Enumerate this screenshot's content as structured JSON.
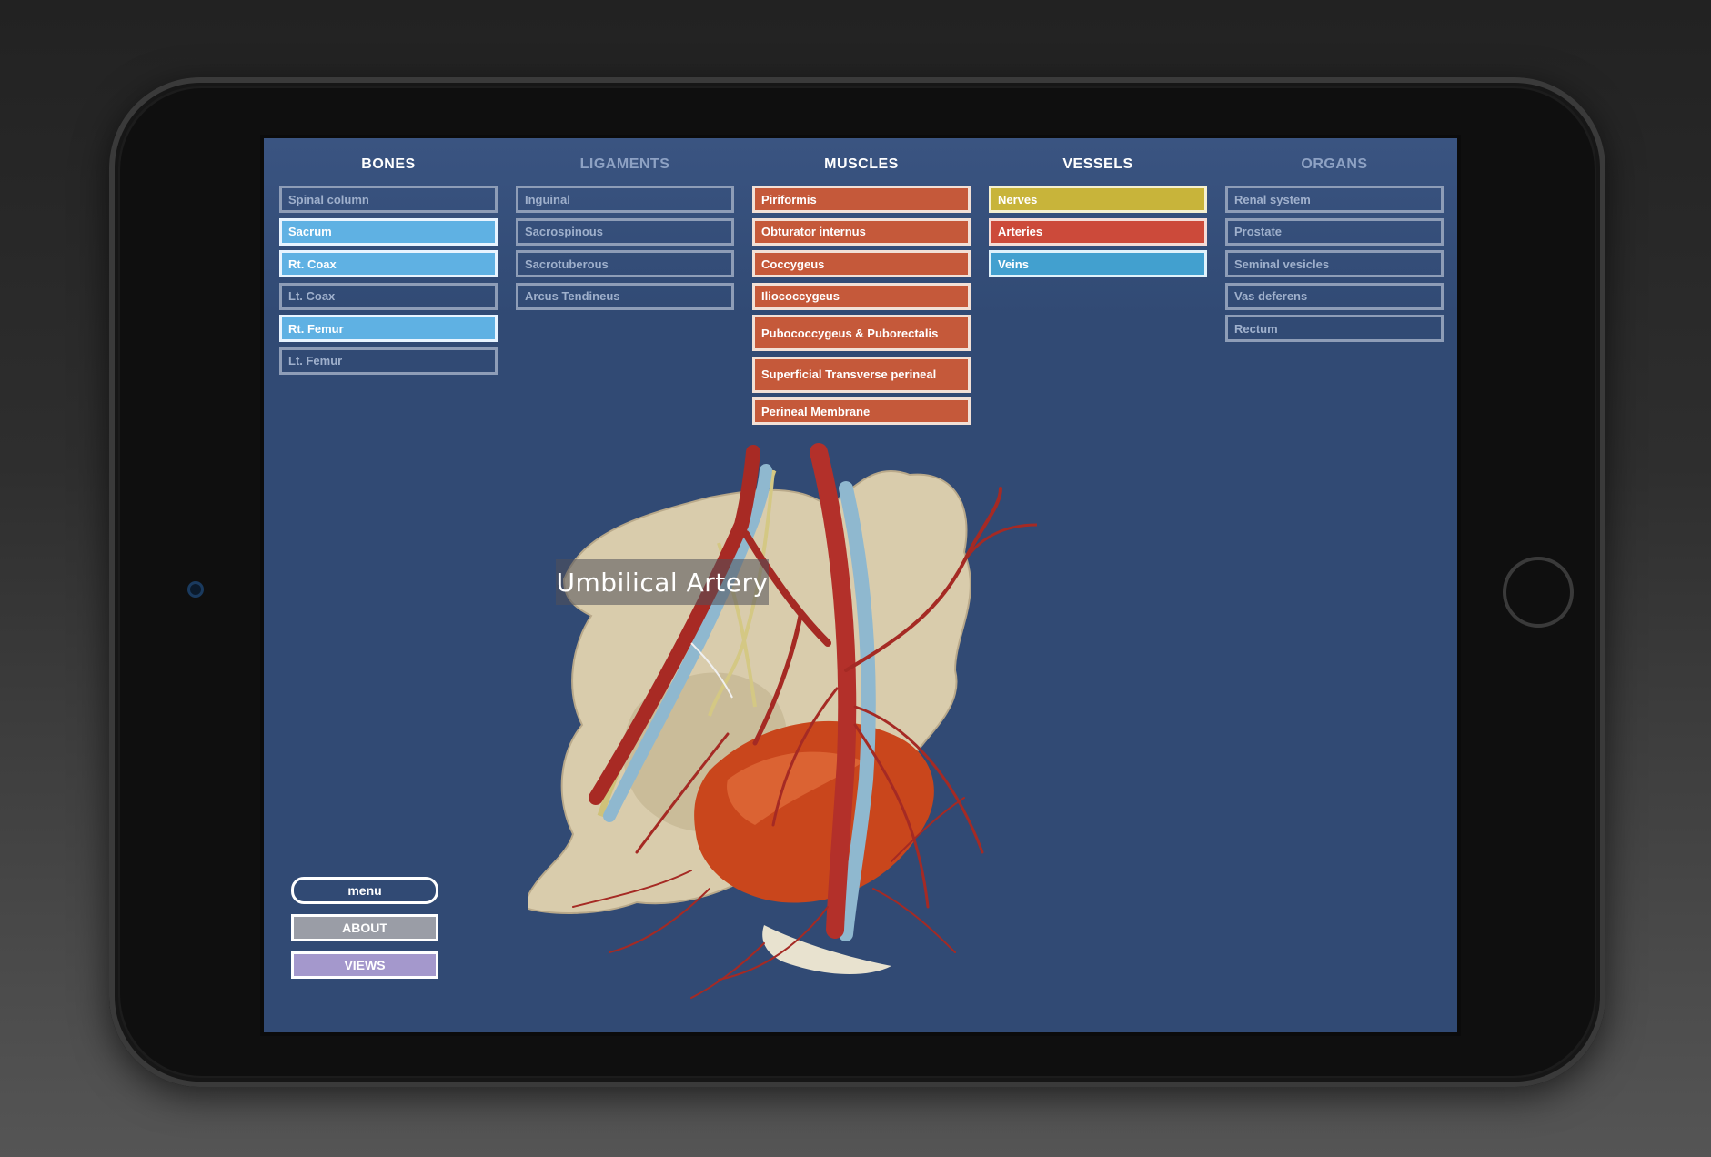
{
  "columns": {
    "bones": {
      "title": "BONES",
      "items": [
        "Spinal column",
        "Sacrum",
        "Rt. Coax",
        "Lt. Coax",
        "Rt. Femur",
        "Lt. Femur"
      ]
    },
    "ligaments": {
      "title": "LIGAMENTS",
      "items": [
        "Inguinal",
        "Sacrospinous",
        "Sacrotuberous",
        "Arcus Tendineus"
      ]
    },
    "muscles": {
      "title": "MUSCLES",
      "items": [
        "Piriformis",
        "Obturator internus",
        "Coccygeus",
        "Iliococcygeus",
        "Pubococcygeus & Puborectalis",
        "Superficial Transverse perineal",
        "Perineal Membrane"
      ]
    },
    "vessels": {
      "title": "VESSELS",
      "items": [
        "Nerves",
        "Arteries",
        "Veins"
      ]
    },
    "organs": {
      "title": "ORGANS",
      "items": [
        "Renal system",
        "Prostate",
        "Seminal vesicles",
        "Vas deferens",
        "Rectum"
      ]
    }
  },
  "model_label": "Umbilical Artery",
  "buttons": {
    "menu": "menu",
    "about": "ABOUT",
    "views": "VIEWS"
  },
  "colors": {
    "screen_bg": "#314a74",
    "bone_selected": "#5fb1e3",
    "muscle": "#c5593a",
    "nerves": "#c8b43a",
    "arteries": "#cc4a3a",
    "veins": "#42a0cf",
    "about_button": "#9a9da6",
    "views_button": "#a498cc"
  }
}
